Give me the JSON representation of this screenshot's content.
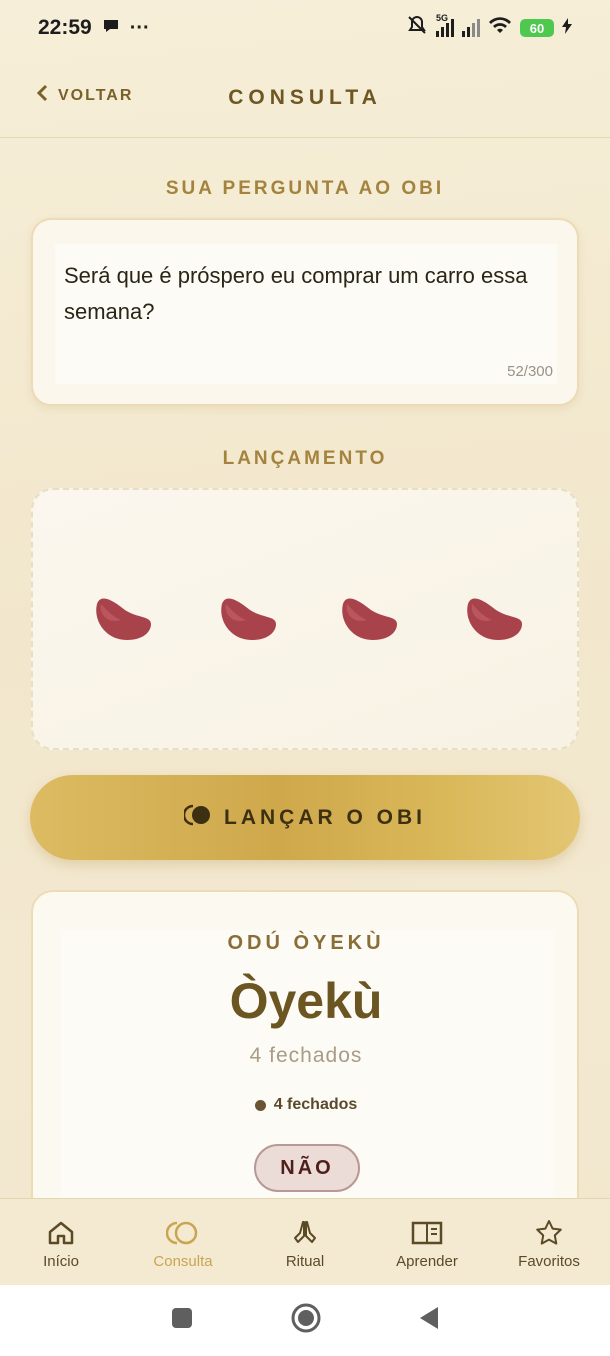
{
  "status_bar": {
    "time": "22:59",
    "ellipsis": "···",
    "network": "5G",
    "battery": "60"
  },
  "header": {
    "back_label": "VOLTAR",
    "title": "CONSULTA"
  },
  "question": {
    "section_label": "SUA PERGUNTA AO OBI",
    "text": "Será que é próspero eu comprar um carro essa semana?",
    "counter": "52/300"
  },
  "throw": {
    "section_label": "LANÇAMENTO",
    "seeds": 4,
    "button_label": "LANÇAR O OBI"
  },
  "result": {
    "odu_label": "ODÚ ÒYEKÙ",
    "odu_name": "Òyekù",
    "subtitle": "4 fechados",
    "detail": "4 fechados",
    "answer": "NÃO"
  },
  "bottom_nav": {
    "items": [
      {
        "label": "Início",
        "icon": "home-icon"
      },
      {
        "label": "Consulta",
        "icon": "obi-icon",
        "active": true
      },
      {
        "label": "Ritual",
        "icon": "praying-hands-icon"
      },
      {
        "label": "Aprender",
        "icon": "book-icon"
      },
      {
        "label": "Favoritos",
        "icon": "star-icon"
      }
    ]
  },
  "colors": {
    "background": "#f3e9d1",
    "accent": "#cfa84b",
    "text_brown": "#6e5722",
    "answer_badge": "#ecdcd8",
    "active_nav": "#c9a552"
  }
}
